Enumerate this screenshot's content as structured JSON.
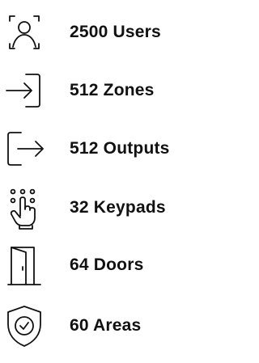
{
  "features": [
    {
      "icon": "user-icon",
      "label": "2500 Users"
    },
    {
      "icon": "sign-in-icon",
      "label": "512 Zones"
    },
    {
      "icon": "sign-out-icon",
      "label": "512 Outputs"
    },
    {
      "icon": "keypad-hand-icon",
      "label": "32 Keypads"
    },
    {
      "icon": "door-icon",
      "label": "64 Doors"
    },
    {
      "icon": "shield-check-icon",
      "label": "60 Areas"
    }
  ],
  "colors": {
    "text": "#111111",
    "background": "#ffffff"
  }
}
